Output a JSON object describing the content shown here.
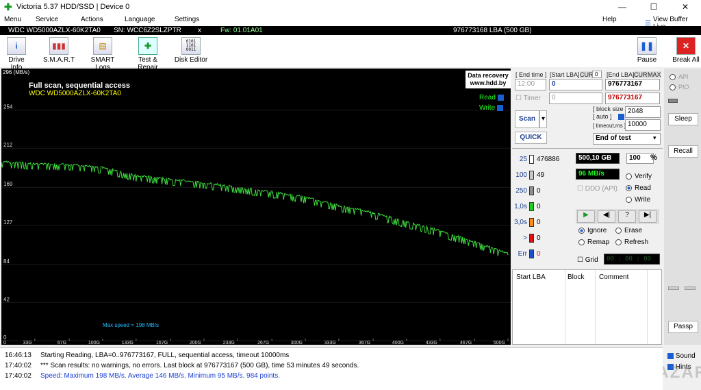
{
  "window": {
    "title": "Victoria 5.37 HDD/SSD | Device 0",
    "minimize": "—",
    "maximize": "☐",
    "close": "✕"
  },
  "menu": {
    "items": [
      "Menu",
      "Service",
      "Actions",
      "Language",
      "Settings"
    ],
    "help": "Help",
    "view_buffer": "View Buffer Live"
  },
  "device": {
    "model": "WDC WD5000AZLX-60K2TA0",
    "serial": "SN: WCC6Z2SLZPTR",
    "close_x": "x",
    "firmware": "Fw: 01.01A01",
    "capacity": "976773168 LBA (500 GB)"
  },
  "toolbar": {
    "drive_info": "Drive Info",
    "smart": "S.M.A.R.T",
    "smart_logs": "SMART Logs",
    "test_repair": "Test & Repair",
    "disk_editor": "Disk Editor",
    "pause": "Pause",
    "break_all": "Break All"
  },
  "graph": {
    "unit": "296 (MB/s)",
    "title": "Full scan, sequential access",
    "model": "WDC WD5000AZLX-60K2TA0",
    "data_recovery": "Data recovery",
    "site": "www.hdd.by",
    "read": "Read",
    "write": "Write",
    "max_speed": "Max speed = 198 MB/s"
  },
  "chart_data": {
    "type": "line",
    "title": "Full scan, sequential access",
    "ylim": [
      0,
      296
    ],
    "y_ticks": [
      "254",
      "212",
      "169",
      "127",
      "84",
      "42",
      "0"
    ],
    "x_ticks": [
      "33G",
      "67G",
      "100G",
      "133G",
      "167G",
      "200G",
      "233G",
      "267G",
      "300G",
      "333G",
      "367G",
      "400G",
      "433G",
      "467G",
      "500G"
    ],
    "xlim": [
      0,
      500
    ],
    "series": [
      {
        "name": "Read",
        "x": [
          0,
          33,
          67,
          100,
          133,
          167,
          200,
          233,
          267,
          300,
          333,
          367,
          400,
          433,
          467,
          500
        ],
        "y": [
          196,
          194,
          193,
          190,
          181,
          177,
          173,
          168,
          163,
          157,
          148,
          140,
          130,
          120,
          108,
          95
        ]
      }
    ]
  },
  "controls": {
    "end_time_label": "[ End time ]",
    "start_lba_label": "[Start LBA]",
    "cur": "CUR",
    "cur_val": "0",
    "end_lba_label": "[End LBA]",
    "max": "MAX",
    "end_time": "12:00",
    "start_lba": "0",
    "end_lba": "976773167",
    "timer": "Timer",
    "timer_val": "0",
    "cur_lba": "976773167",
    "scan": "Scan",
    "quick": "QUICK",
    "block_size_label": "[ block size ]",
    "auto_label": "[ auto ]",
    "timeout_label": "[ timeout,ms ]",
    "block_size": "2048",
    "timeout": "10000",
    "end_mode": "End of test"
  },
  "stats": {
    "blocks": [
      {
        "label": "25",
        "count": "476886",
        "color": "#ffffff"
      },
      {
        "label": "100",
        "count": "49",
        "color": "#c8c8c8"
      },
      {
        "label": "250",
        "count": "0",
        "color": "#909090"
      },
      {
        "label": "1,0s",
        "count": "0",
        "color": "#22cc22"
      },
      {
        "label": "3,0s",
        "count": "0",
        "color": "#ff8c1a"
      },
      {
        "label": ">",
        "count": "0",
        "color": "#dd1111"
      },
      {
        "label": "Err",
        "count": "0",
        "color": "#1a4fd0"
      }
    ],
    "size": "500,10 GB",
    "percent": "100",
    "pct_sign": "%",
    "speed": "96 MB/s",
    "ddd": "DDD (API)",
    "verify": "Verify",
    "read": "Read",
    "write": "Write",
    "ignore": "Ignore",
    "erase": "Erase",
    "remap": "Remap",
    "refresh": "Refresh",
    "grid": "Grid",
    "grid_time": "00 : 00 : 00"
  },
  "table": {
    "headers": [
      "Start LBA",
      "Block",
      "Comment"
    ]
  },
  "side": {
    "api": "API",
    "pio": "PIO",
    "sleep": "Sleep",
    "recall": "Recall",
    "passp": "Passp",
    "sound": "Sound",
    "hints": "Hints"
  },
  "log": [
    {
      "time": "16:46:13",
      "text": "Starting Reading, LBA=0..976773167, FULL, sequential access, timeout 10000ms",
      "color": "#000000"
    },
    {
      "time": "17:40:02",
      "text": "*** Scan results: no warnings, no errors. Last block at 976773167 (500 GB), time 53 minutes 49 seconds.",
      "color": "#000000"
    },
    {
      "time": "17:40:02",
      "text": "Speed: Maximum 198 MB/s. Average 146 MB/s. Minimum 95 MB/s. 984 points.",
      "color": "#1a3fd0"
    }
  ],
  "watermark": "BAZAR"
}
